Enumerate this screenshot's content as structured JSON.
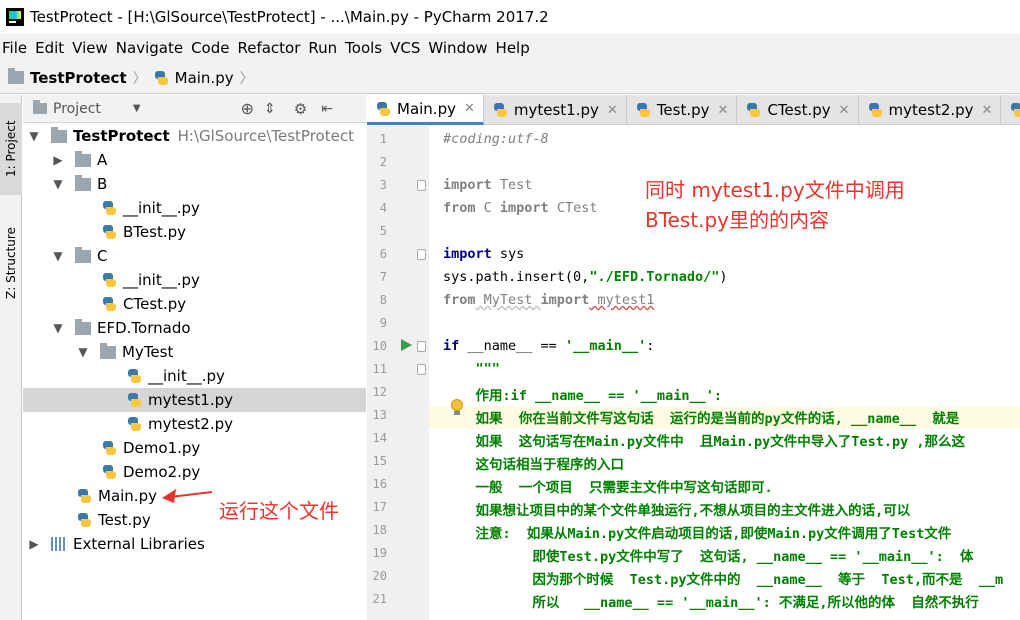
{
  "window": {
    "title": "TestProtect - [H:\\GlSource\\TestProtect] - ...\\Main.py - PyCharm 2017.2"
  },
  "menu": [
    "File",
    "Edit",
    "View",
    "Navigate",
    "Code",
    "Refactor",
    "Run",
    "Tools",
    "VCS",
    "Window",
    "Help"
  ],
  "breadcrumb": {
    "project": "TestProtect",
    "file": "Main.py"
  },
  "sidebar": {
    "tab_project": "1: Project",
    "tab_structure": "Z: Structure"
  },
  "project_panel": {
    "header": "Project",
    "tree": [
      {
        "label": "TestProtect",
        "path": "H:\\GlSource\\TestProtect",
        "type": "folder",
        "expanded": true
      },
      {
        "label": "A",
        "type": "folder",
        "expanded": false
      },
      {
        "label": "B",
        "type": "folder",
        "expanded": true
      },
      {
        "label": "__init__.py",
        "type": "py"
      },
      {
        "label": "BTest.py",
        "type": "py"
      },
      {
        "label": "C",
        "type": "folder",
        "expanded": true
      },
      {
        "label": "__init__.py",
        "type": "py"
      },
      {
        "label": "CTest.py",
        "type": "py"
      },
      {
        "label": "EFD.Tornado",
        "type": "folder",
        "expanded": true
      },
      {
        "label": "MyTest",
        "type": "folder",
        "expanded": true
      },
      {
        "label": "__init__.py",
        "type": "py"
      },
      {
        "label": "mytest1.py",
        "type": "py",
        "selected": true
      },
      {
        "label": "mytest2.py",
        "type": "py"
      },
      {
        "label": "Demo1.py",
        "type": "py"
      },
      {
        "label": "Demo2.py",
        "type": "py"
      },
      {
        "label": "Main.py",
        "type": "py"
      },
      {
        "label": "Test.py",
        "type": "py"
      },
      {
        "label": "External Libraries",
        "type": "lib",
        "expanded": false
      }
    ]
  },
  "editor_tabs": [
    {
      "label": "Main.py",
      "active": true
    },
    {
      "label": "mytest1.py",
      "active": false
    },
    {
      "label": "Test.py",
      "active": false
    },
    {
      "label": "CTest.py",
      "active": false
    },
    {
      "label": "mytest2.py",
      "active": false
    }
  ],
  "code": {
    "line_numbers": [
      "1",
      "2",
      "3",
      "4",
      "5",
      "6",
      "7",
      "8",
      "9",
      "10",
      "11",
      "12",
      "13",
      "14",
      "15",
      "16",
      "17",
      "18",
      "19",
      "20",
      "21"
    ],
    "l1": "#coding:utf-8",
    "l3a": "import",
    "l3b": " Test",
    "l4a": "from",
    "l4b": " C ",
    "l4c": "import",
    "l4d": " CTest",
    "l6a": "import",
    "l6b": " sys",
    "l7a": "sys.path.insert(0,",
    "l7b": "\"./EFD.Tornado/\"",
    "l7c": ")",
    "l8a": "from",
    "l8b": " MyTest ",
    "l8c": "import",
    "l8d": " mytest1",
    "l10a": "if",
    "l10b": " __name__ == ",
    "l10c": "'__main__'",
    "l10d": ":",
    "l11": "    \"\"\"",
    "l12": "    作用:if __name__ == '__main__':",
    "l13": "    如果  你在当前文件写这句话  运行的是当前的py文件的话, __name__  就是",
    "l14": "    如果  这句话写在Main.py文件中  且Main.py文件中导入了Test.py ,那么这",
    "l15": "    这句话相当于程序的入口",
    "l16": "    一般  一个项目  只需要主文件中写这句话即可.",
    "l17": "    如果想让项目中的某个文件单独运行,不想从项目的主文件进入的话,可以",
    "l18": "    注意:  如果从Main.py文件启动项目的话,即使Main.py文件调用了Test文件",
    "l19": "           即使Test.py文件中写了  这句话, __name__ == '__main__':  体",
    "l20": "           因为那个时候  Test.py文件中的  __name__  等于  Test,而不是  __m",
    "l21": "           所以   __name__ == '__main__': 不满足,所以他的体  自然不执行"
  },
  "annotations": {
    "editor_note_1": "同时 mytest1.py文件中调用",
    "editor_note_2": "BTest.py里的的内容",
    "tree_note": "运行这个文件"
  },
  "colors": {
    "annotation": "#e8352b",
    "selection": "#d5d5d5",
    "active_tab": "#4083c9"
  }
}
